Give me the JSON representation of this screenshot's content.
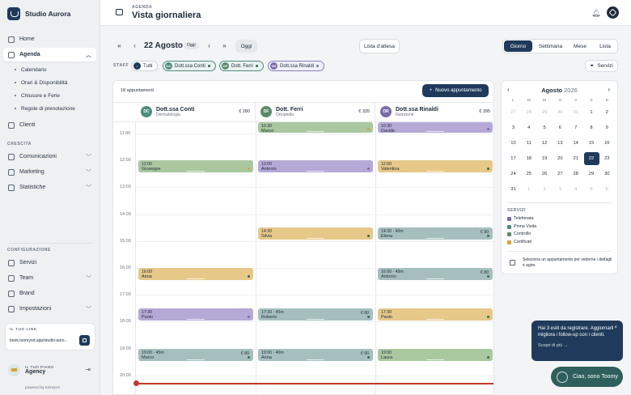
{
  "brand": {
    "name": "Studio Aurora"
  },
  "nav": {
    "home": "Home",
    "agenda": "Agenda",
    "sub": [
      "Calendario",
      "Orari & Disponibilità",
      "Chiusure e Ferie",
      "Regole di prenotazione"
    ],
    "clients": "Clienti"
  },
  "sections": {
    "growth": "CRESCITA",
    "config": "CONFIGURAZIONE"
  },
  "growth": [
    "Comunicazioni",
    "Marketing",
    "Statistiche"
  ],
  "config": [
    "Servizi",
    "Team",
    "Brand",
    "Impostazioni"
  ],
  "link": {
    "label": "IL TUO LINK",
    "url": "book.toomynd.app/studio-auro..."
  },
  "plan": {
    "label": "IL TUO PIANO",
    "name": "Agency",
    "powered": "powered by toomynd"
  },
  "header": {
    "eyebrow": "AGENDA",
    "title": "Vista giornaliera"
  },
  "toolbar": {
    "date": "22 Agosto",
    "today_badge": "Oggi",
    "today_btn": "Oggi",
    "waitlist": "Lista d'attesa",
    "views": [
      "Giorno",
      "Settimana",
      "Mese",
      "Lista"
    ],
    "staff_label": "STAFF",
    "all": "Tutti",
    "services_btn": "Servizi",
    "new_appt": "Nuovo appuntamento",
    "count": "18 appuntamenti"
  },
  "staff": [
    {
      "initials": "DC",
      "name": "Dott.ssa Conti",
      "spec": "Dermatologia",
      "price": "€ 280",
      "color": "#4c8c7c"
    },
    {
      "initials": "DF",
      "name": "Dott. Ferri",
      "spec": "Ortopedia",
      "price": "€ 335",
      "color": "#5b8a6a"
    },
    {
      "initials": "DR",
      "name": "Dott.ssa Rinaldi",
      "spec": "Nutrizione",
      "price": "€ 395",
      "color": "#7a6aa8"
    }
  ],
  "hours": [
    "11:00",
    "12:00",
    "13:00",
    "14:00",
    "15:00",
    "16:00",
    "17:00",
    "18:00",
    "19:00",
    "20:00"
  ],
  "appointments": [
    {
      "col": 1,
      "start": "10:30",
      "name": "Marco",
      "cls": "c-green",
      "dot": "#d6a23a",
      "price": ""
    },
    {
      "col": 2,
      "start": "10:30",
      "name": "Davide",
      "cls": "c-purple",
      "dot": "#7a6aa8",
      "price": ""
    },
    {
      "col": 0,
      "start": "12:00",
      "name": "Giuseppe",
      "cls": "c-green",
      "dot": "#d6a23a",
      "price": ""
    },
    {
      "col": 1,
      "start": "12:00",
      "name": "Antonio",
      "cls": "c-purple",
      "dot": "#7a6aa8",
      "price": ""
    },
    {
      "col": 2,
      "start": "12:00",
      "name": "Valentina",
      "cls": "c-orange",
      "dot": "#2e6b52",
      "price": ""
    },
    {
      "col": 1,
      "start": "14:30",
      "name": "Silvia",
      "cls": "c-orange",
      "dot": "#2e6b52",
      "price": ""
    },
    {
      "col": 2,
      "start": "14:30 · 40m",
      "name": "Elena",
      "cls": "c-blue",
      "dot": "#2e6b52",
      "price": "€ 90"
    },
    {
      "col": 0,
      "start": "16:00",
      "name": "Anna",
      "cls": "c-orange",
      "dot": "#2e6b52",
      "price": ""
    },
    {
      "col": 2,
      "start": "16:00 · 45m",
      "name": "Antonio",
      "cls": "c-blue",
      "dot": "#2e6b52",
      "price": "€ 80"
    },
    {
      "col": 0,
      "start": "17:30",
      "name": "Paolo",
      "cls": "c-purple",
      "dot": "#7a6aa8",
      "price": ""
    },
    {
      "col": 1,
      "start": "17:30 · 45m",
      "name": "Roberto",
      "cls": "c-blue",
      "dot": "#2e6b52",
      "price": "€ 80"
    },
    {
      "col": 2,
      "start": "17:30",
      "name": "Paolo",
      "cls": "c-orange",
      "dot": "#2e6b52",
      "price": ""
    },
    {
      "col": 0,
      "start": "19:00 · 45m",
      "name": "Marco",
      "cls": "c-blue",
      "dot": "#2e6b52",
      "price": "€ 80"
    },
    {
      "col": 1,
      "start": "19:00 · 40m",
      "name": "Anna",
      "cls": "c-blue",
      "dot": "#2e6b52",
      "price": "€ 90"
    },
    {
      "col": 2,
      "start": "19:00",
      "name": "Laura",
      "cls": "c-green",
      "dot": "#2e6b52",
      "price": ""
    }
  ],
  "mini": {
    "title": "Agosto",
    "year": "2026",
    "weekdays": [
      "L",
      "M",
      "M",
      "G",
      "V",
      "S",
      "D"
    ],
    "days": [
      [
        "27",
        "28",
        "29",
        "30",
        "31",
        "1",
        "2"
      ],
      [
        "3",
        "4",
        "5",
        "6",
        "7",
        "8",
        "9"
      ],
      [
        "10",
        "11",
        "12",
        "13",
        "14",
        "15",
        "16"
      ],
      [
        "17",
        "18",
        "19",
        "20",
        "21",
        "22",
        "23"
      ],
      [
        "24",
        "25",
        "26",
        "27",
        "28",
        "29",
        "30"
      ],
      [
        "31",
        "1",
        "2",
        "3",
        "4",
        "5",
        "6"
      ]
    ]
  },
  "services": {
    "title": "SERVIZI",
    "items": [
      {
        "label": "Telefonata",
        "color": "#7a6aa8"
      },
      {
        "label": "Prima Visita",
        "color": "#4c8c7c"
      },
      {
        "label": "Controllo",
        "color": "#5b8a6a"
      },
      {
        "label": "Certificati",
        "color": "#d6a23a"
      }
    ]
  },
  "hint": "Seleziona un appuntamento per vederne i dettagli e agire.",
  "toast": {
    "text": "Hai 3 esiti da registrare. Aggiornarli migliora i follow-up con i clienti.",
    "link": "Scopri di più →"
  },
  "toomy": "Ciao, sono Toomy"
}
